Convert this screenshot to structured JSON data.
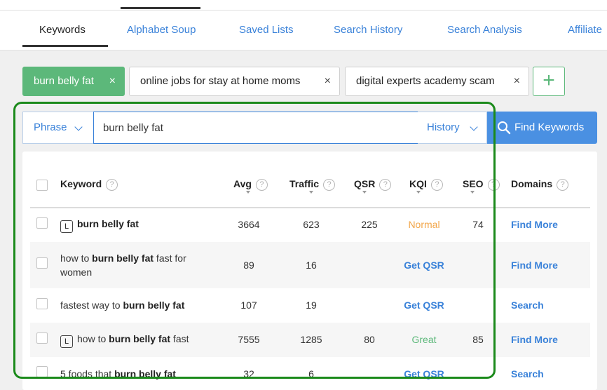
{
  "tabs": [
    {
      "label": "Keywords",
      "active": true
    },
    {
      "label": "Alphabet Soup"
    },
    {
      "label": "Saved Lists"
    },
    {
      "label": "Search History"
    },
    {
      "label": "Search Analysis"
    },
    {
      "label": "Affiliate"
    }
  ],
  "chips": [
    {
      "label": "burn belly fat",
      "active": true
    },
    {
      "label": "online jobs for stay at home moms"
    },
    {
      "label": "digital experts academy scam"
    }
  ],
  "chip_close_glyph": "×",
  "add_glyph": "+",
  "search": {
    "mode": "Phrase",
    "query": "burn belly fat",
    "history_label": "History",
    "find_label": "Find Keywords"
  },
  "table": {
    "headers": {
      "keyword": "Keyword",
      "avg": "Avg",
      "traffic": "Traffic",
      "qsr": "QSR",
      "kqi": "KQI",
      "seo": "SEO",
      "domains": "Domains"
    },
    "help_glyph": "?",
    "badge_letter": "L",
    "rows": [
      {
        "kw_pre": "",
        "kw_bold": "burn belly fat",
        "kw_post": "",
        "kw_line2": "",
        "avg": "3664",
        "traffic": "623",
        "qsr": "225",
        "kqi": "Normal",
        "seo": "74",
        "domains": "Find More"
      },
      {
        "kw_pre": "how to ",
        "kw_bold": "burn belly fat",
        "kw_post": " fast for",
        "kw_line2": "women",
        "avg": "89",
        "traffic": "16",
        "qsr": "Get QSR",
        "kqi": "",
        "seo": "",
        "domains": "Find More"
      },
      {
        "kw_pre": "fastest way to ",
        "kw_bold": "burn belly fat",
        "kw_post": "",
        "kw_line2": "",
        "avg": "107",
        "traffic": "19",
        "qsr": "Get QSR",
        "kqi": "",
        "seo": "",
        "domains": "Search"
      },
      {
        "kw_pre": "how to ",
        "kw_bold": "burn belly fat",
        "kw_post": " fast",
        "kw_line2": "",
        "avg": "7555",
        "traffic": "1285",
        "qsr": "80",
        "kqi": "Great",
        "seo": "85",
        "domains": "Find More"
      },
      {
        "kw_pre": "5 foods that ",
        "kw_bold": "burn belly fat",
        "kw_post": "",
        "kw_line2": "",
        "avg": "32",
        "traffic": "6",
        "qsr": "Get QSR",
        "kqi": "",
        "seo": "",
        "domains": "Search"
      }
    ]
  },
  "colors": {
    "accent_blue": "#3a82d9",
    "button_blue": "#4a90e2",
    "chip_green": "#5cb87a",
    "kqi_normal": "#f2a649",
    "kqi_great": "#5cb87a",
    "highlight_outline": "#1b8a1b"
  }
}
